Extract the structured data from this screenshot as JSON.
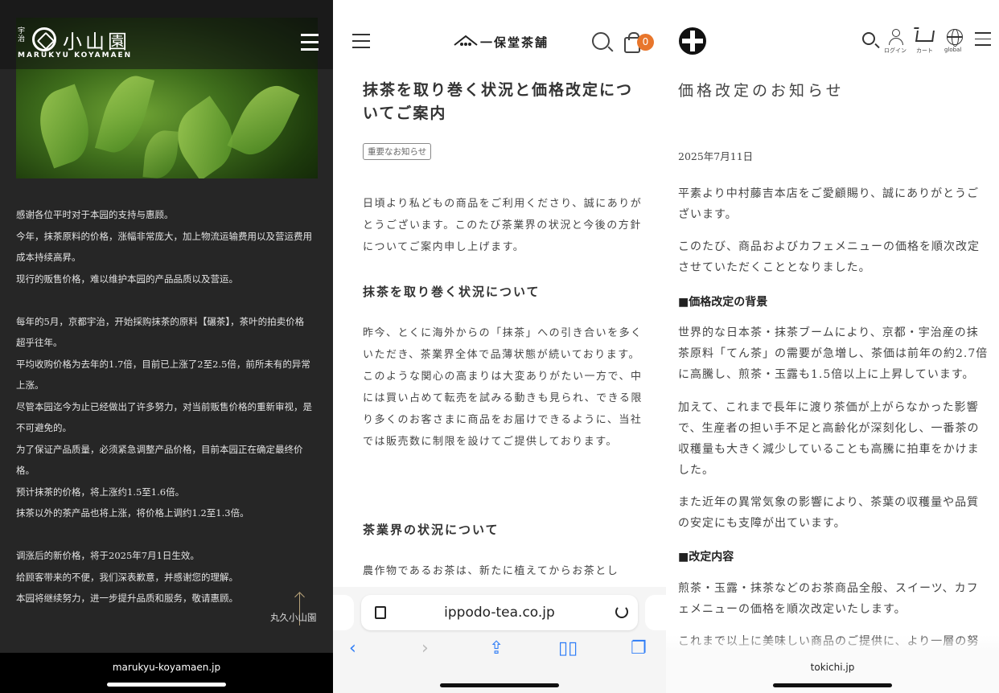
{
  "panel1": {
    "logo_side": "宇治",
    "logo_kanji": "小山園",
    "logo_roman": "MARUKYU KOYAMAEN",
    "lines": [
      "感谢各位平时对于本园的支持与惠顾。",
      "今年，抹茶原料的价格，涨幅非常庞大，加上物流运输费用以及营运费用",
      "成本持续高昇。",
      "现行的贩售价格，难以维护本园的产品品质以及营运。",
      "",
      "每年的5月，京都宇治，开始採购抹茶的原料【碾茶】，茶叶的拍卖价格",
      "超乎往年。",
      "平均收购价格为去年的1.7倍，目前已上涨了2至2.5倍，前所未有的异常",
      "上涨。",
      "尽管本园迄今为止已经做出了许多努力，对当前贩售价格的重新审视，是",
      "不可避免的。",
      "为了保证产品质量，必须紧急调整产品价格，目前本园正在确定最终价",
      "格。",
      "预计抹茶的价格，将上涨约1.5至1.6倍。",
      "抹茶以外的茶产品也将上涨，将价格上调约1.2至1.3倍。",
      "",
      "调涨后的新价格，将于2025年7月1日生效。",
      "给顾客带来的不便，我们深表歉意，并感谢您的理解。",
      "本园将继续努力，进一步提升品质和服务，敬请惠顾。"
    ],
    "signature": "丸久小山園",
    "url": "marukyu-koyamaen.jp"
  },
  "panel2": {
    "logo_text": "一保堂茶舗",
    "cart_count": "0",
    "title": "抹茶を取り巻く状況と価格改定についてご案内",
    "tag": "重要なお知らせ",
    "intro": "日頃より私どもの商品をご利用くださり、誠にありがとうございます。このたび茶業界の状況と今後の方針についてご案内申し上げます。",
    "section1_heading": "抹茶を取り巻く状況について",
    "section1_body": "昨今、とくに海外からの「抹茶」への引き合いを多くいただき、茶業界全体で品薄状態が続いております。このような関心の高まりは大変ありがたい一方で、中には買い占めて転売を試みる動きも見られ、できる限り多くのお客さまに商品をお届けできるように、当社では販売数に制限を設けてご提供しております。",
    "section2_heading": "茶業界の状況について",
    "section2_body": "農作物であるお茶は、新たに植えてからお茶とし",
    "url": "ippodo-tea.co.jp"
  },
  "panel3": {
    "labels": {
      "login": "ログイン",
      "cart": "カート",
      "global": "global"
    },
    "title": "価格改定のお知らせ",
    "date": "2025年7月11日",
    "p1": "平素より中村藤吉本店をご愛顧賜り、誠にありがとうございます。",
    "p2": "このたび、商品およびカフェメニューの価格を順次改定させていただくこととなりました。",
    "h1": "■価格改定の背景",
    "p3": "世界的な日本茶・抹茶ブームにより、京都・宇治産の抹茶原料「てん茶」の需要が急増し、茶価は前年の約2.7倍に高騰し、煎茶・玉露も1.5倍以上に上昇しています。",
    "p4": "加えて、これまで長年に渡り茶価が上がらなかった影響で、生産者の担い手不足と高齢化が深刻化し、一番茶の収穫量も大きく減少していることも高騰に拍車をかけました。",
    "p5": "また近年の異常気象の影響により、茶葉の収穫量や品質の安定にも支障が出ています。",
    "h2": "■改定内容",
    "p6": "煎茶・玉露・抹茶などのお茶商品全般、スイーツ、カフェメニューの価格を順次改定いたします。",
    "p7": "これまで以上に美味しい商品のご提供に、より一層の努",
    "url": "tokichi.jp"
  }
}
